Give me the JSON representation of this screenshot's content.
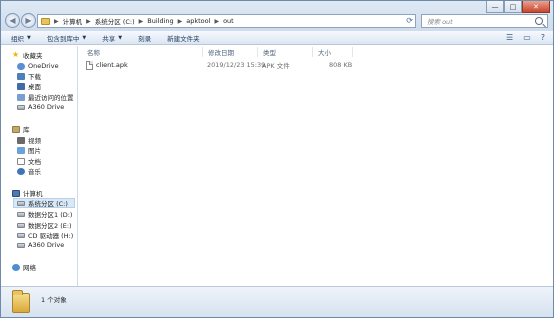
{
  "window": {
    "buttons": {
      "minimize": "—",
      "maximize": "□",
      "close": "✕"
    }
  },
  "address": {
    "crumbs": [
      "计算机",
      "系统分区 (C:)",
      "Building",
      "apktool",
      "out"
    ]
  },
  "search": {
    "placeholder": "搜索 out"
  },
  "toolbar": {
    "organize": "组织",
    "burn_to_disk": "包含到库中",
    "share": "共享",
    "burn": "刻录",
    "new_folder": "新建文件夹"
  },
  "nav": {
    "favorites": {
      "label": "收藏夹",
      "items": [
        "OneDrive",
        "下载",
        "桌面",
        "最近访问的位置",
        "A360 Drive"
      ]
    },
    "libraries": {
      "label": "库",
      "items": [
        "视频",
        "图片",
        "文档",
        "音乐"
      ]
    },
    "computer": {
      "label": "计算机",
      "items": [
        "系统分区 (C:)",
        "数据分区1 (D:)",
        "数据分区2 (E:)",
        "CD 驱动器 (H:)",
        "A360 Drive"
      ]
    },
    "network": {
      "label": "网络"
    }
  },
  "columns": {
    "name": "名称",
    "modified": "修改日期",
    "type": "类型",
    "size": "大小"
  },
  "files": [
    {
      "name": "client.apk",
      "modified": "2019/12/23 15:39",
      "type": "APK 文件",
      "size": "808 KB"
    }
  ],
  "status": {
    "count": "1 个对象"
  }
}
